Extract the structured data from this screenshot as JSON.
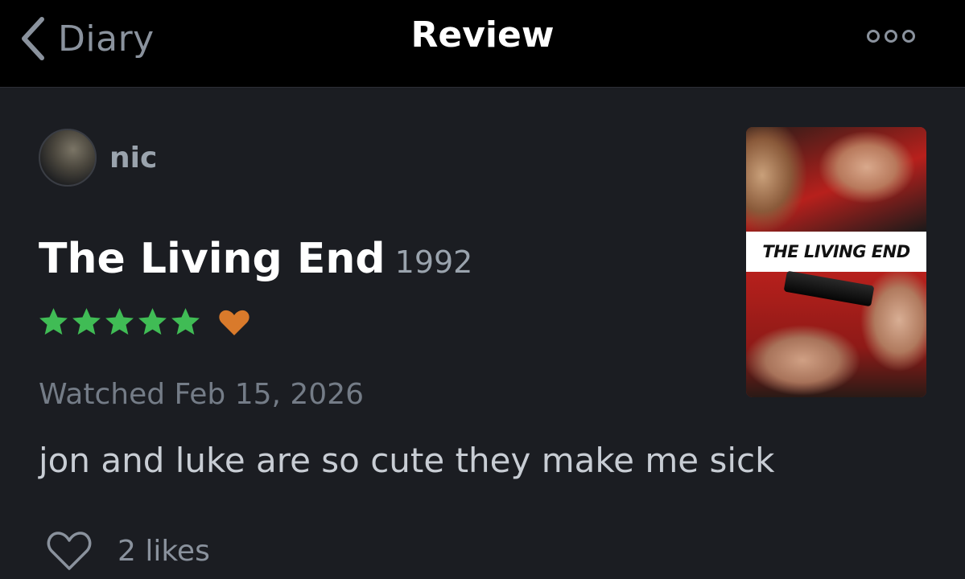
{
  "nav": {
    "back_label": "Diary",
    "title": "Review"
  },
  "review": {
    "author": "nic",
    "film_title": "The Living End",
    "film_year": "1992",
    "rating_stars": 5,
    "liked": true,
    "watched": "Watched Feb 15, 2026",
    "text": "jon and luke are so cute they make me sick",
    "likes": "2 likes"
  },
  "poster": {
    "title": "THE LIVING END"
  },
  "colors": {
    "star": "#40bc55",
    "heart": "#d97a2b",
    "background": "#1b1d22",
    "nav_background": "#000000"
  },
  "icons": [
    "chevron-left-icon",
    "more-icon",
    "star-icon",
    "heart-icon",
    "heart-outline-icon"
  ]
}
